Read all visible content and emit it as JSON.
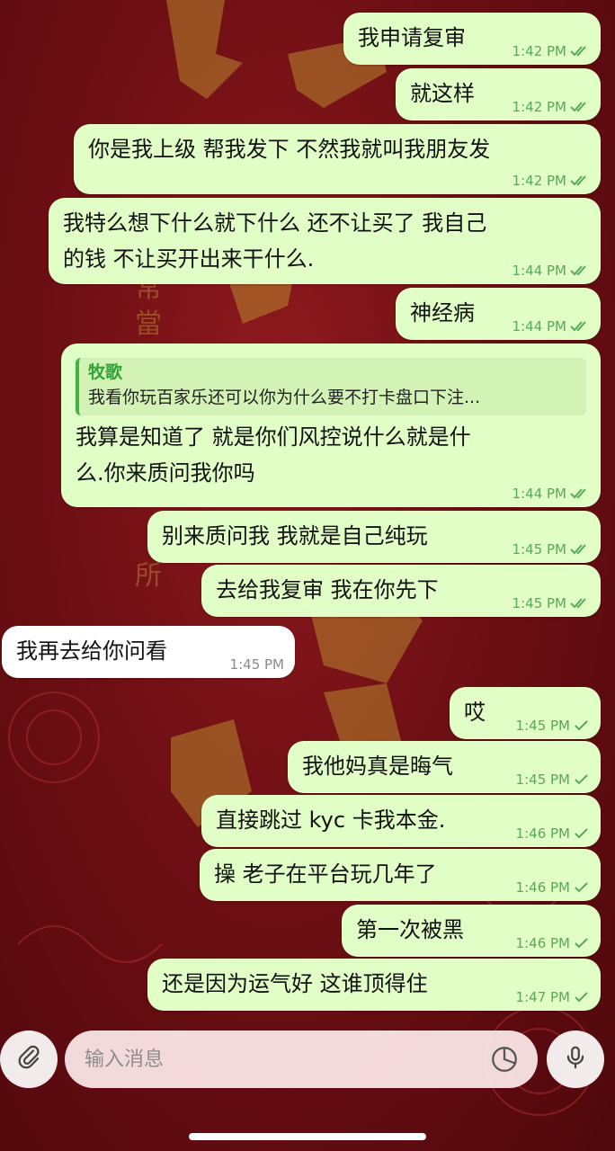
{
  "messages": [
    {
      "text": "我申请复审",
      "time": "1:42 PM",
      "status": "read",
      "dir": "out"
    },
    {
      "text": "就这样",
      "time": "1:42 PM",
      "status": "read",
      "dir": "out"
    },
    {
      "text": "你是我上级 帮我发下 不然我就叫我朋友发",
      "time": "1:42 PM",
      "status": "read",
      "dir": "out"
    },
    {
      "text": "我特么想下什么就下什么 还不让买了 我自己\n的钱 不让买开出来干什么.",
      "time": "1:44 PM",
      "status": "read",
      "dir": "out"
    },
    {
      "text": "神经病",
      "time": "1:44 PM",
      "status": "read",
      "dir": "out"
    },
    {
      "text": "我算是知道了 就是你们风控说什么就是什\n么.你来质问我你吗",
      "time": "1:44 PM",
      "status": "read",
      "dir": "out",
      "reply_to": {
        "name": "牧歌",
        "text": "我看你玩百家乐还可以你为什么要不打卡盘口下注..."
      }
    },
    {
      "text": "别来质问我 我就是自己纯玩",
      "time": "1:45 PM",
      "status": "read",
      "dir": "out"
    },
    {
      "text": "去给我复审 我在你先下",
      "time": "1:45 PM",
      "status": "read",
      "dir": "out"
    },
    {
      "text": "我再去给你问看",
      "time": "1:45 PM",
      "status": "",
      "dir": "in"
    },
    {
      "text": "哎",
      "time": "1:45 PM",
      "status": "sent",
      "dir": "out"
    },
    {
      "text": "我他妈真是晦气",
      "time": "1:45 PM",
      "status": "sent",
      "dir": "out"
    },
    {
      "text": "直接跳过 kyc 卡我本金.",
      "time": "1:46 PM",
      "status": "sent",
      "dir": "out"
    },
    {
      "text": "操 老子在平台玩几年了",
      "time": "1:46 PM",
      "status": "sent",
      "dir": "out"
    },
    {
      "text": "第一次被黑",
      "time": "1:46 PM",
      "status": "sent",
      "dir": "out"
    },
    {
      "text": "还是因为运气好 这谁顶得住",
      "time": "1:47 PM",
      "status": "sent",
      "dir": "out"
    }
  ],
  "composer": {
    "placeholder": "输入消息",
    "attach_icon": "paperclip-icon",
    "sticker_icon": "sticker-icon",
    "mic_icon": "microphone-icon"
  },
  "colors": {
    "outgoing_bubble": "#e1fec6",
    "incoming_bubble": "#ffffff",
    "accent_green": "#3fb23f",
    "background_red": "#7a1015"
  }
}
